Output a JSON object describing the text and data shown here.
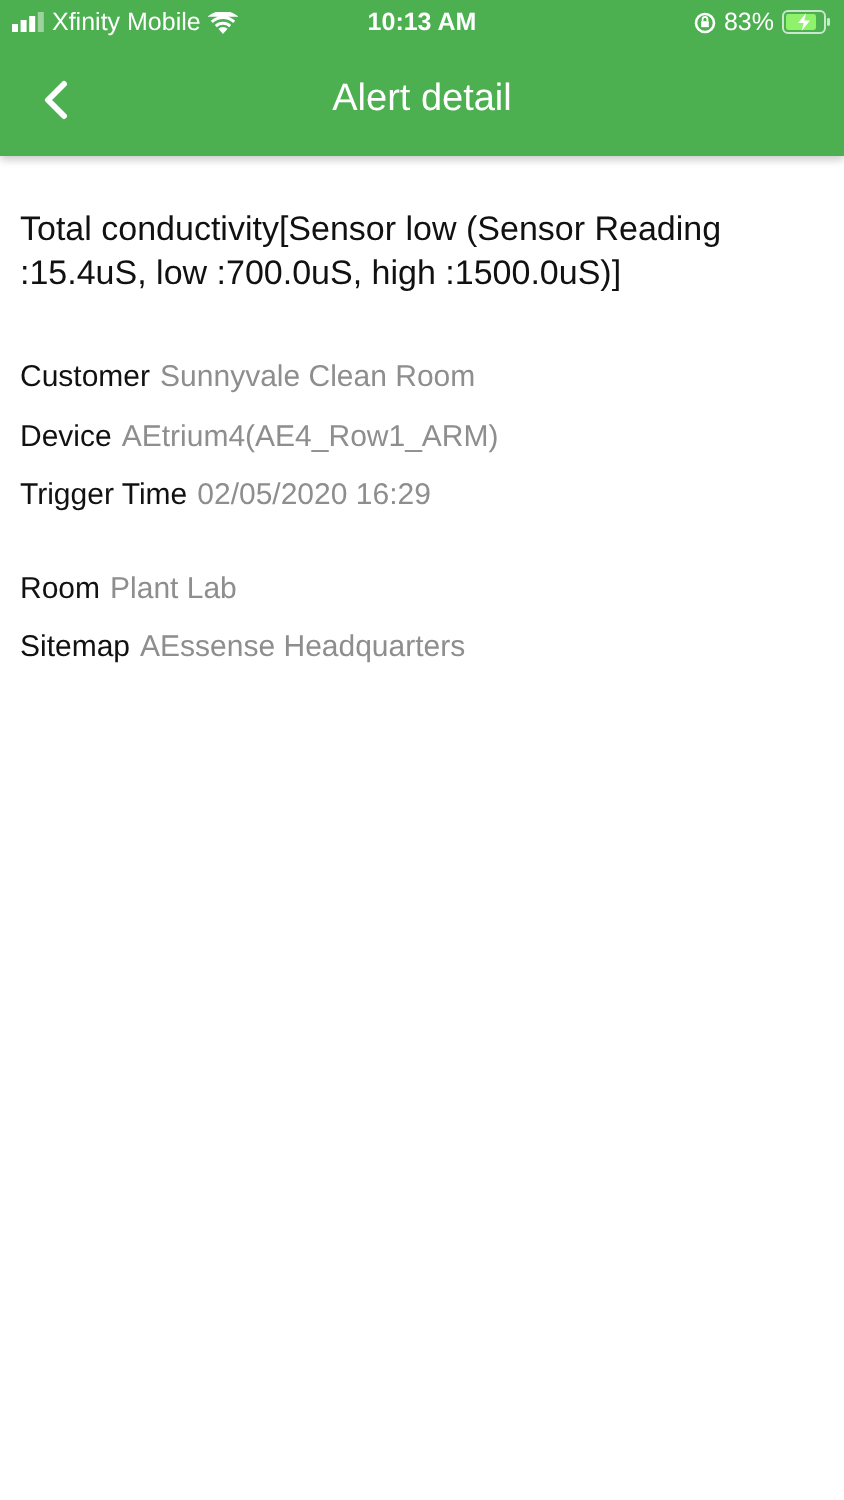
{
  "status_bar": {
    "carrier": "Xfinity Mobile",
    "time": "10:13 AM",
    "battery": "83%"
  },
  "nav_bar": {
    "title": "Alert detail"
  },
  "alert": {
    "message": "Total conductivity[Sensor low (Sensor Reading :15.4uS, low :700.0uS, high :1500.0uS)]"
  },
  "field_groups": [
    [
      {
        "label": "Customer",
        "value": "Sunnyvale Clean Room"
      },
      {
        "label": "Device",
        "value": "AEtrium4(AE4_Row1_ARM)"
      },
      {
        "label": "Trigger Time",
        "value": "02/05/2020 16:29"
      }
    ],
    [
      {
        "label": "Room",
        "value": "Plant Lab"
      },
      {
        "label": "Sitemap",
        "value": "AEssense Headquarters"
      }
    ]
  ]
}
